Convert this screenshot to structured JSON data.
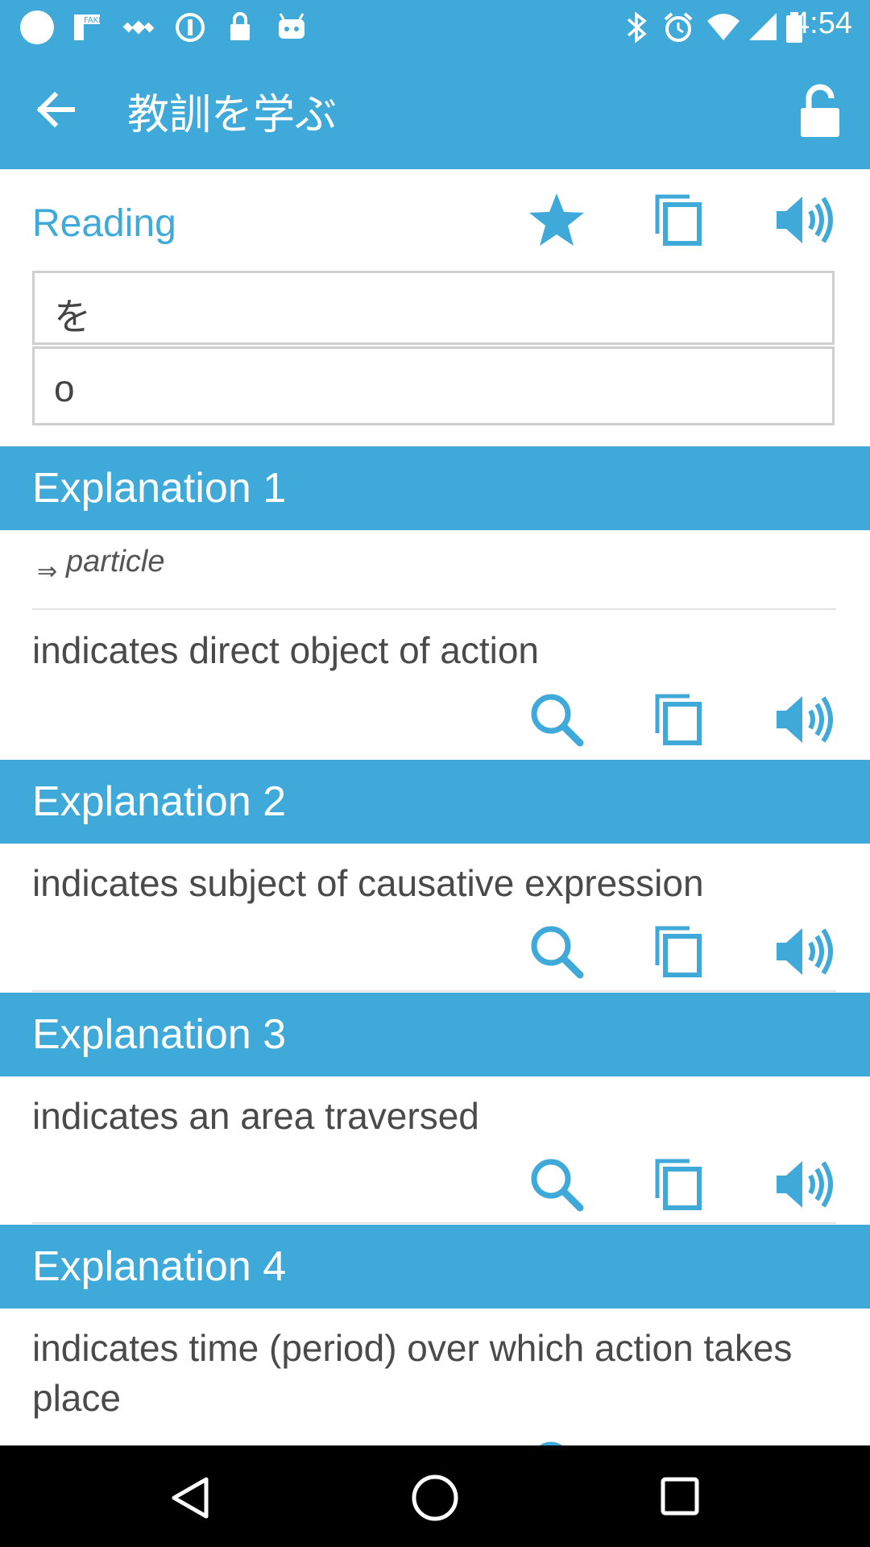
{
  "status_bar": {
    "time": "4:54",
    "icons": [
      "circle-icon",
      "fake-gps-icon",
      "satellite-icon",
      "data-saver-icon",
      "lock-notification-icon",
      "android-icon",
      "bluetooth-icon",
      "alarm-icon",
      "wifi-icon",
      "signal-icon",
      "battery-icon"
    ]
  },
  "app_bar": {
    "title": "教訓を学ぶ",
    "back_icon": "arrow-left-icon",
    "lock_icon": "lock-icon"
  },
  "reading": {
    "label": "Reading",
    "kana": "を",
    "romaji": "o",
    "actions": [
      "star-icon",
      "copy-icon",
      "speaker-icon"
    ]
  },
  "explanations": [
    {
      "heading": "Explanation 1",
      "part_of_speech": "particle",
      "text": "indicates direct object of action"
    },
    {
      "heading": "Explanation 2",
      "text": "indicates subject of causative expression"
    },
    {
      "heading": "Explanation 3",
      "text": "indicates an area traversed"
    },
    {
      "heading": "Explanation 4",
      "text": "indicates time (period) over which action takes place"
    }
  ],
  "row_actions": [
    "search-icon",
    "copy-icon",
    "speaker-icon"
  ],
  "nav_bar": [
    "back-triangle-icon",
    "home-circle-icon",
    "recents-square-icon"
  ],
  "colors": {
    "accent": "#3fa9d9",
    "status_bar": "#3fa9d9",
    "text": "#4a4a4a",
    "nav_bar": "#000000"
  }
}
